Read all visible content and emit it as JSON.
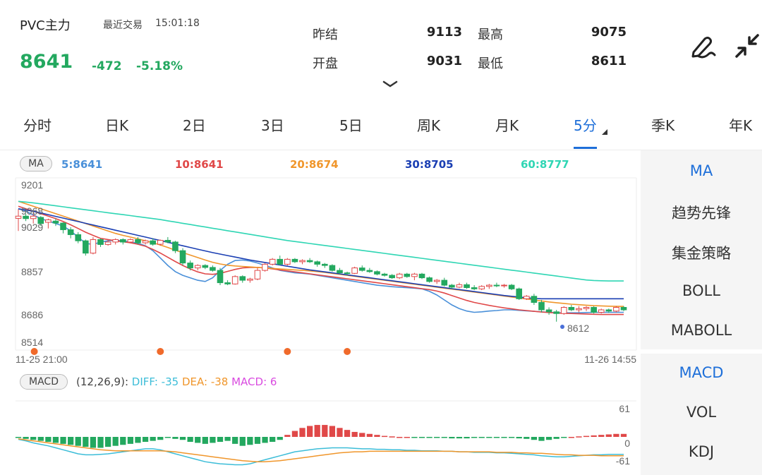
{
  "header": {
    "symbol": "PVC主力",
    "trade_label": "最近交易",
    "trade_time": "15:01:18",
    "price": "8641",
    "change": "-472",
    "change_pct": "-5.18%"
  },
  "quote": {
    "prev_settle_label": "昨结",
    "prev_settle": "9113",
    "high_label": "最高",
    "high": "9075",
    "open_label": "开盘",
    "open": "9031",
    "low_label": "最低",
    "low": "8611"
  },
  "tabs": [
    "分时",
    "日K",
    "2日",
    "3日",
    "5日",
    "周K",
    "月K",
    "5分",
    "季K",
    "年K"
  ],
  "active_tab": 7,
  "ma_legend": {
    "label": "MA",
    "items": [
      {
        "text": "5:8641",
        "color": "#4a90d9"
      },
      {
        "text": "10:8641",
        "color": "#e04848"
      },
      {
        "text": "20:8674",
        "color": "#f0962b"
      },
      {
        "text": "30:8705",
        "color": "#1b3fb3"
      },
      {
        "text": "60:8777",
        "color": "#2fd6b4"
      }
    ]
  },
  "price_axis": [
    "9201",
    "8857",
    "8686",
    "8514"
  ],
  "time_axis": {
    "start": "11-25 21:00",
    "end": "11-26 14:55"
  },
  "annotations": {
    "high_mark": "9068",
    "open_mark": "9029",
    "low_mark": "8612"
  },
  "macd_info": {
    "label": "MACD",
    "params": "(12,26,9):",
    "diff": "DIFF: -35",
    "diff_color": "#3cbdd8",
    "dea": "DEA: -38",
    "dea_color": "#f0962b",
    "macd": "MACD: 6",
    "macd_color": "#d94be0"
  },
  "macd_axis": {
    "top": "61",
    "mid": "0",
    "bottom": "-61"
  },
  "side_menu": {
    "top": [
      "MA",
      "趋势先锋",
      "集金策略",
      "BOLL",
      "MABOLL"
    ],
    "bottom": [
      "MACD",
      "VOL",
      "KDJ"
    ]
  },
  "colors": {
    "up": "#e04848",
    "down": "#23a85f",
    "accent": "#1e6fd9"
  },
  "icons": {
    "edit": "pen-icon",
    "collapse": "shrink-icon",
    "expand": "chevron-down-icon"
  },
  "chart_data": {
    "type": "candlestick",
    "ylim": [
      8514,
      9201
    ],
    "candles_ohlc": [
      [
        9031,
        9068,
        8980,
        9040
      ],
      [
        9040,
        9050,
        9020,
        9030
      ],
      [
        9030,
        9060,
        9010,
        9040
      ],
      [
        9035,
        9040,
        9000,
        9010
      ],
      [
        9015,
        9030,
        8990,
        9025
      ],
      [
        9020,
        9030,
        9000,
        9012
      ],
      [
        9012,
        9015,
        8970,
        8985
      ],
      [
        8985,
        8995,
        8950,
        8965
      ],
      [
        8965,
        8975,
        8930,
        8940
      ],
      [
        8940,
        8945,
        8880,
        8890
      ],
      [
        8890,
        8955,
        8885,
        8945
      ],
      [
        8945,
        8950,
        8915,
        8925
      ],
      [
        8925,
        8945,
        8920,
        8935
      ],
      [
        8935,
        8950,
        8925,
        8945
      ],
      [
        8945,
        8950,
        8925,
        8935
      ],
      [
        8935,
        8950,
        8930,
        8945
      ],
      [
        8945,
        8955,
        8925,
        8932
      ],
      [
        8932,
        8945,
        8925,
        8940
      ],
      [
        8940,
        8950,
        8920,
        8926
      ],
      [
        8926,
        8945,
        8920,
        8942
      ],
      [
        8942,
        8955,
        8930,
        8935
      ],
      [
        8935,
        8940,
        8890,
        8900
      ],
      [
        8900,
        8910,
        8840,
        8850
      ],
      [
        8850,
        8860,
        8820,
        8830
      ],
      [
        8830,
        8845,
        8820,
        8840
      ],
      [
        8840,
        8845,
        8825,
        8832
      ],
      [
        8832,
        8840,
        8815,
        8820
      ],
      [
        8820,
        8830,
        8760,
        8770
      ],
      [
        8770,
        8780,
        8760,
        8765
      ],
      [
        8765,
        8800,
        8762,
        8795
      ],
      [
        8795,
        8800,
        8770,
        8780
      ],
      [
        8780,
        8790,
        8770,
        8785
      ],
      [
        8785,
        8830,
        8780,
        8820
      ],
      [
        8820,
        8850,
        8815,
        8845
      ],
      [
        8845,
        8870,
        8840,
        8865
      ],
      [
        8865,
        8880,
        8840,
        8845
      ],
      [
        8845,
        8870,
        8840,
        8865
      ],
      [
        8865,
        8870,
        8850,
        8855
      ],
      [
        8855,
        8865,
        8845,
        8860
      ],
      [
        8860,
        8870,
        8850,
        8855
      ],
      [
        8855,
        8860,
        8835,
        8845
      ],
      [
        8845,
        8850,
        8830,
        8840
      ],
      [
        8840,
        8845,
        8815,
        8820
      ],
      [
        8820,
        8830,
        8805,
        8810
      ],
      [
        8810,
        8815,
        8800,
        8808
      ],
      [
        8808,
        8835,
        8805,
        8830
      ],
      [
        8830,
        8840,
        8815,
        8820
      ],
      [
        8820,
        8830,
        8810,
        8815
      ],
      [
        8815,
        8820,
        8800,
        8805
      ],
      [
        8805,
        8810,
        8795,
        8800
      ],
      [
        8800,
        8805,
        8785,
        8790
      ],
      [
        8790,
        8810,
        8785,
        8805
      ],
      [
        8805,
        8810,
        8790,
        8795
      ],
      [
        8795,
        8810,
        8780,
        8805
      ],
      [
        8805,
        8810,
        8785,
        8790
      ],
      [
        8790,
        8795,
        8770,
        8775
      ],
      [
        8775,
        8785,
        8765,
        8780
      ],
      [
        8780,
        8790,
        8755,
        8760
      ],
      [
        8760,
        8765,
        8745,
        8752
      ],
      [
        8752,
        8770,
        8748,
        8762
      ],
      [
        8762,
        8770,
        8745,
        8750
      ],
      [
        8750,
        8760,
        8740,
        8745
      ],
      [
        8745,
        8760,
        8740,
        8755
      ],
      [
        8755,
        8765,
        8745,
        8760
      ],
      [
        8760,
        8770,
        8752,
        8758
      ],
      [
        8758,
        8765,
        8750,
        8760
      ],
      [
        8760,
        8765,
        8740,
        8745
      ],
      [
        8745,
        8750,
        8700,
        8705
      ],
      [
        8705,
        8720,
        8700,
        8715
      ],
      [
        8715,
        8725,
        8680,
        8690
      ],
      [
        8690,
        8700,
        8650,
        8660
      ],
      [
        8660,
        8670,
        8640,
        8652
      ],
      [
        8652,
        8660,
        8612,
        8645
      ],
      [
        8645,
        8675,
        8640,
        8670
      ],
      [
        8670,
        8680,
        8655,
        8660
      ],
      [
        8660,
        8675,
        8650,
        8665
      ],
      [
        8665,
        8675,
        8655,
        8670
      ],
      [
        8670,
        8675,
        8645,
        8650
      ],
      [
        8650,
        8665,
        8645,
        8660
      ],
      [
        8660,
        8665,
        8648,
        8655
      ],
      [
        8655,
        8675,
        8650,
        8670
      ],
      [
        8670,
        8675,
        8655,
        8660
      ]
    ],
    "ma_series": [
      {
        "name": "5",
        "color": "#4a90d9",
        "values": [
          9070,
          9060,
          9045,
          9030,
          9020,
          9010,
          9000,
          8980,
          8955,
          8930,
          8925,
          8935,
          8940,
          8942,
          8940,
          8935,
          8930,
          8920,
          8900,
          8870,
          8840,
          8815,
          8800,
          8790,
          8780,
          8775,
          8790,
          8820,
          8845,
          8860,
          8862,
          8858,
          8850,
          8840,
          8830,
          8820,
          8815,
          8810,
          8808,
          8805,
          8800,
          8795,
          8790,
          8785,
          8780,
          8775,
          8770,
          8765,
          8760,
          8757,
          8754,
          8752,
          8750,
          8748,
          8745,
          8735,
          8720,
          8700,
          8680,
          8665,
          8655,
          8650,
          8652,
          8655,
          8657,
          8660,
          8660,
          8658,
          8656,
          8654,
          8652,
          8650,
          8648,
          8648,
          8648,
          8648,
          8649,
          8650,
          8650,
          8650,
          8650,
          8650
        ]
      },
      {
        "name": "10",
        "color": "#e04848",
        "values": [
          9080,
          9070,
          9060,
          9050,
          9040,
          9030,
          9018,
          9005,
          8990,
          8975,
          8962,
          8950,
          8945,
          8940,
          8936,
          8932,
          8926,
          8918,
          8905,
          8890,
          8873,
          8856,
          8840,
          8826,
          8814,
          8806,
          8804,
          8808,
          8816,
          8824,
          8830,
          8832,
          8832,
          8830,
          8826,
          8822,
          8818,
          8814,
          8810,
          8806,
          8802,
          8798,
          8794,
          8790,
          8786,
          8782,
          8778,
          8774,
          8770,
          8766,
          8762,
          8758,
          8754,
          8750,
          8746,
          8742,
          8736,
          8728,
          8718,
          8708,
          8698,
          8690,
          8684,
          8678,
          8673,
          8668,
          8664,
          8660,
          8657,
          8654,
          8651,
          8649,
          8647,
          8646,
          8645,
          8644,
          8643,
          8642,
          8641,
          8641,
          8641,
          8641
        ]
      },
      {
        "name": "20",
        "color": "#f0962b",
        "values": [
          9100,
          9090,
          9080,
          9070,
          9060,
          9050,
          9040,
          9030,
          9020,
          9010,
          9000,
          8990,
          8980,
          8970,
          8962,
          8955,
          8948,
          8940,
          8932,
          8923,
          8913,
          8902,
          8892,
          8882,
          8872,
          8862,
          8853,
          8846,
          8841,
          8838,
          8836,
          8834,
          8832,
          8830,
          8828,
          8826,
          8824,
          8822,
          8820,
          8818,
          8815,
          8812,
          8808,
          8804,
          8800,
          8796,
          8792,
          8788,
          8784,
          8780,
          8776,
          8772,
          8768,
          8764,
          8760,
          8756,
          8752,
          8748,
          8744,
          8740,
          8736,
          8732,
          8728,
          8724,
          8720,
          8716,
          8712,
          8708,
          8704,
          8700,
          8696,
          8692,
          8689,
          8686,
          8683,
          8681,
          8679,
          8677,
          8676,
          8675,
          8674,
          8674
        ]
      },
      {
        "name": "30",
        "color": "#1b3fb3",
        "values": [
          9070,
          9065,
          9060,
          9053,
          9046,
          9039,
          9032,
          9025,
          9018,
          9011,
          9004,
          8997,
          8990,
          8983,
          8976,
          8969,
          8962,
          8955,
          8948,
          8941,
          8934,
          8927,
          8920,
          8913,
          8906,
          8899,
          8892,
          8886,
          8880,
          8874,
          8868,
          8862,
          8857,
          8852,
          8847,
          8842,
          8837,
          8832,
          8827,
          8822,
          8818,
          8814,
          8810,
          8806,
          8802,
          8798,
          8794,
          8790,
          8786,
          8782,
          8778,
          8774,
          8770,
          8766,
          8762,
          8758,
          8754,
          8750,
          8746,
          8742,
          8738,
          8734,
          8730,
          8726,
          8722,
          8718,
          8715,
          8712,
          8709,
          8706,
          8705,
          8705,
          8705,
          8705,
          8705,
          8705,
          8705,
          8705,
          8705,
          8705,
          8705,
          8705
        ]
      },
      {
        "name": "60",
        "color": "#2fd6b4",
        "values": [
          9100,
          9097,
          9094,
          9090,
          9086,
          9082,
          9078,
          9074,
          9070,
          9066,
          9062,
          9058,
          9054,
          9050,
          9046,
          9042,
          9038,
          9034,
          9030,
          9026,
          9021,
          9016,
          9011,
          9006,
          9001,
          8996,
          8991,
          8986,
          8981,
          8976,
          8971,
          8966,
          8961,
          8956,
          8951,
          8946,
          8941,
          8937,
          8933,
          8929,
          8925,
          8921,
          8917,
          8913,
          8909,
          8905,
          8901,
          8897,
          8893,
          8889,
          8885,
          8881,
          8877,
          8873,
          8869,
          8865,
          8861,
          8857,
          8853,
          8849,
          8845,
          8841,
          8837,
          8833,
          8829,
          8825,
          8821,
          8817,
          8813,
          8809,
          8805,
          8801,
          8797,
          8793,
          8789,
          8785,
          8781,
          8779,
          8778,
          8777,
          8777,
          8777
        ]
      }
    ],
    "signal_markers_index": [
      1,
      19,
      36,
      44
    ],
    "macd": {
      "ylim": [
        -61,
        61
      ],
      "hist": [
        -2,
        -4,
        -6,
        -8,
        -10,
        -12,
        -14,
        -16,
        -18,
        -20,
        -22,
        -22,
        -20,
        -18,
        -16,
        -14,
        -12,
        -10,
        -8,
        -6,
        -2,
        -4,
        -6,
        -10,
        -12,
        -14,
        -12,
        -10,
        -8,
        -14,
        -18,
        -16,
        -14,
        -12,
        -10,
        -6,
        4,
        12,
        18,
        22,
        24,
        24,
        22,
        18,
        14,
        10,
        8,
        6,
        4,
        2,
        1,
        0,
        0,
        -1,
        -1,
        -2,
        -2,
        -2,
        -3,
        -3,
        -3,
        -2,
        -2,
        -2,
        -1,
        -1,
        -2,
        -3,
        -4,
        -6,
        -8,
        -6,
        -4,
        -2,
        0,
        1,
        2,
        3,
        4,
        5,
        6,
        6
      ],
      "diff": [
        -5,
        -8,
        -12,
        -15,
        -18,
        -22,
        -26,
        -30,
        -34,
        -36,
        -36,
        -35,
        -34,
        -32,
        -30,
        -28,
        -26,
        -24,
        -24,
        -26,
        -30,
        -34,
        -38,
        -42,
        -46,
        -50,
        -52,
        -54,
        -55,
        -56,
        -56,
        -54,
        -50,
        -46,
        -42,
        -38,
        -34,
        -30,
        -28,
        -26,
        -24,
        -23,
        -22,
        -22,
        -22,
        -23,
        -24,
        -24,
        -25,
        -25,
        -26,
        -26,
        -27,
        -27,
        -28,
        -28,
        -28,
        -29,
        -29,
        -30,
        -30,
        -31,
        -31,
        -31,
        -32,
        -32,
        -33,
        -34,
        -35,
        -36,
        -38,
        -39,
        -40,
        -40,
        -39,
        -38,
        -37,
        -36,
        -36,
        -35,
        -35,
        -35
      ],
      "dea": [
        -4,
        -6,
        -8,
        -10,
        -12,
        -14,
        -16,
        -18,
        -20,
        -22,
        -24,
        -26,
        -27,
        -28,
        -28,
        -28,
        -28,
        -28,
        -28,
        -28,
        -29,
        -30,
        -32,
        -34,
        -36,
        -38,
        -40,
        -42,
        -44,
        -46,
        -48,
        -49,
        -50,
        -50,
        -49,
        -48,
        -46,
        -44,
        -42,
        -40,
        -38,
        -36,
        -34,
        -32,
        -31,
        -30,
        -30,
        -29,
        -29,
        -29,
        -29,
        -29,
        -29,
        -29,
        -29,
        -29,
        -29,
        -29,
        -29,
        -30,
        -30,
        -30,
        -30,
        -30,
        -31,
        -31,
        -31,
        -32,
        -32,
        -33,
        -33,
        -34,
        -35,
        -36,
        -36,
        -37,
        -37,
        -37,
        -38,
        -38,
        -38,
        -38
      ]
    }
  }
}
